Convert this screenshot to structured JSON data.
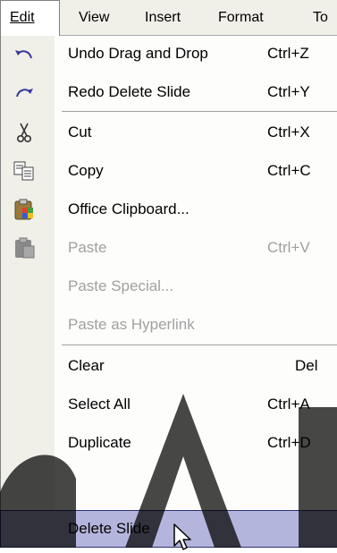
{
  "menubar": {
    "items": [
      {
        "label": "Edit",
        "active": true
      },
      {
        "label": "View"
      },
      {
        "label": "Insert"
      },
      {
        "label": "Format"
      },
      {
        "label": "To"
      }
    ]
  },
  "edit_menu": {
    "items": [
      {
        "label": "Undo Drag and Drop",
        "shortcut": "Ctrl+Z",
        "icon": "undo-icon"
      },
      {
        "label": "Redo Delete Slide",
        "shortcut": "Ctrl+Y",
        "icon": "redo-icon"
      },
      {
        "label": "Cut",
        "shortcut": "Ctrl+X",
        "icon": "scissors-icon"
      },
      {
        "label": "Copy",
        "shortcut": "Ctrl+C",
        "icon": "copy-icon"
      },
      {
        "label": "Office Clipboard...",
        "shortcut": "",
        "icon": "office-clipboard-icon"
      },
      {
        "label": "Paste",
        "shortcut": "Ctrl+V",
        "icon": "paste-icon",
        "disabled": true
      },
      {
        "label": "Paste Special...",
        "shortcut": "",
        "disabled": true
      },
      {
        "label": "Paste as Hyperlink",
        "shortcut": "",
        "disabled": true
      },
      {
        "label": "Clear",
        "shortcut": "Del"
      },
      {
        "label": "Select All",
        "shortcut": "Ctrl+A"
      },
      {
        "label": "Duplicate",
        "shortcut": "Ctrl+D"
      },
      {
        "label": "Delete Slide",
        "shortcut": "",
        "highlighted": true
      }
    ]
  },
  "colors": {
    "menu_background": "#f0efe8",
    "highlight": "#b4b5dc",
    "disabled_text": "#a0a0a0"
  }
}
